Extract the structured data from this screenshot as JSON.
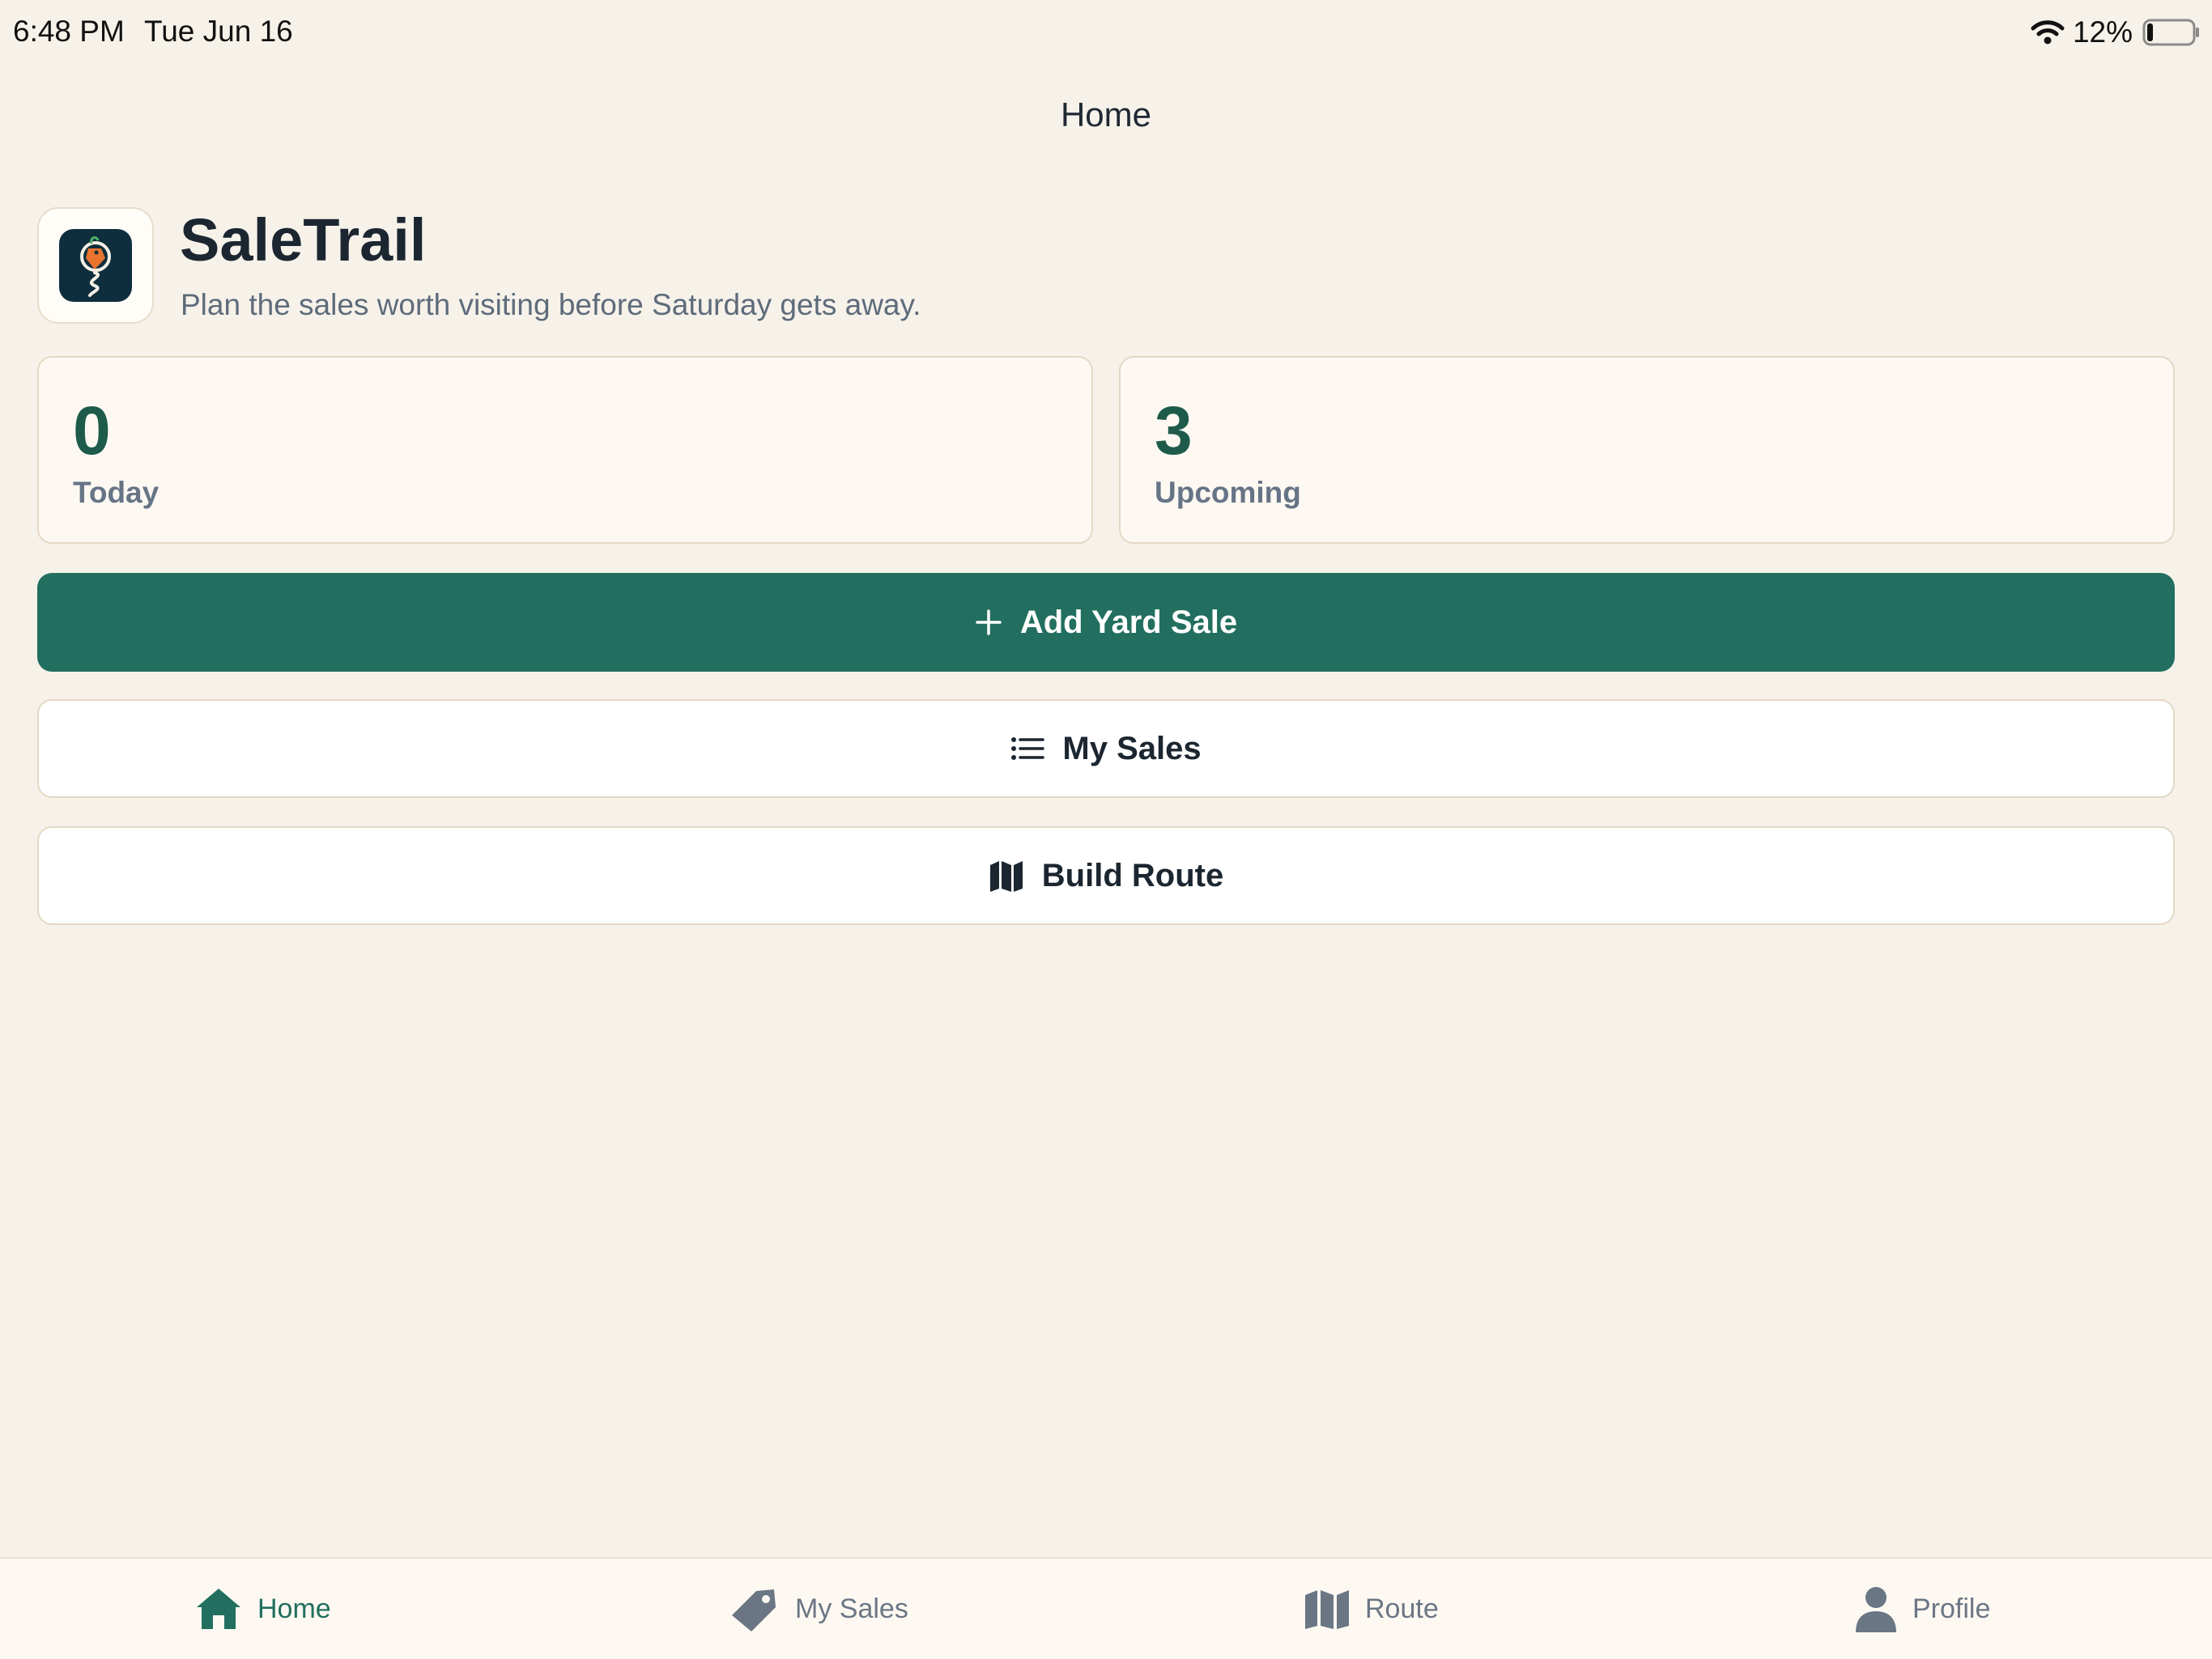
{
  "status_bar": {
    "time": "6:48 PM",
    "date": "Tue Jun 16",
    "battery": "12%"
  },
  "nav": {
    "title": "Home"
  },
  "header": {
    "app_name": "SaleTrail",
    "tagline": "Plan the sales worth visiting before Saturday gets away.",
    "logo_icon": "saletrail-logo"
  },
  "stats": [
    {
      "value": "0",
      "label": "Today"
    },
    {
      "value": "3",
      "label": "Upcoming"
    }
  ],
  "actions": {
    "add_label": "Add Yard Sale",
    "add_icon": "plus-icon",
    "my_sales_label": "My Sales",
    "my_sales_icon": "list-icon",
    "route_label": "Build Route",
    "route_icon": "map-icon"
  },
  "tabs": [
    {
      "label": "Home",
      "icon": "home-icon",
      "active": true
    },
    {
      "label": "My Sales",
      "icon": "tag-icon",
      "active": false
    },
    {
      "label": "Route",
      "icon": "map-icon",
      "active": false
    },
    {
      "label": "Profile",
      "icon": "person-icon",
      "active": false
    }
  ],
  "colors": {
    "background": "#f6f2ea",
    "accent": "#226f5f",
    "stat_number": "#1e5b4b",
    "muted_text": "#667486"
  }
}
